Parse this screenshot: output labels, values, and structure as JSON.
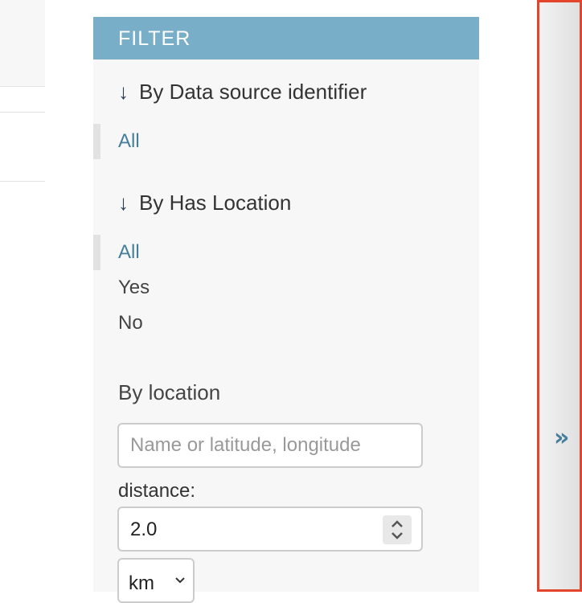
{
  "filter": {
    "header": "FILTER",
    "sections": [
      {
        "title": "By Data source identifier",
        "arrow": "↓",
        "options": [
          {
            "label": "All",
            "selected": true
          }
        ]
      },
      {
        "title": "By Has Location",
        "arrow": "↓",
        "options": [
          {
            "label": "All",
            "selected": true
          },
          {
            "label": "Yes",
            "selected": false
          },
          {
            "label": "No",
            "selected": false
          }
        ]
      }
    ],
    "location": {
      "title": "By location",
      "placeholder": "Name or latitude, longitude",
      "distance_label": "distance:",
      "distance_value": "2.0",
      "unit_value": "km"
    }
  },
  "sidebar_toggle": {
    "glyph": "»",
    "icon": "double-chevron-right-icon"
  },
  "colors": {
    "header_bg": "#79aec8",
    "link": "#447e9b",
    "highlight_border": "#e2452b"
  }
}
